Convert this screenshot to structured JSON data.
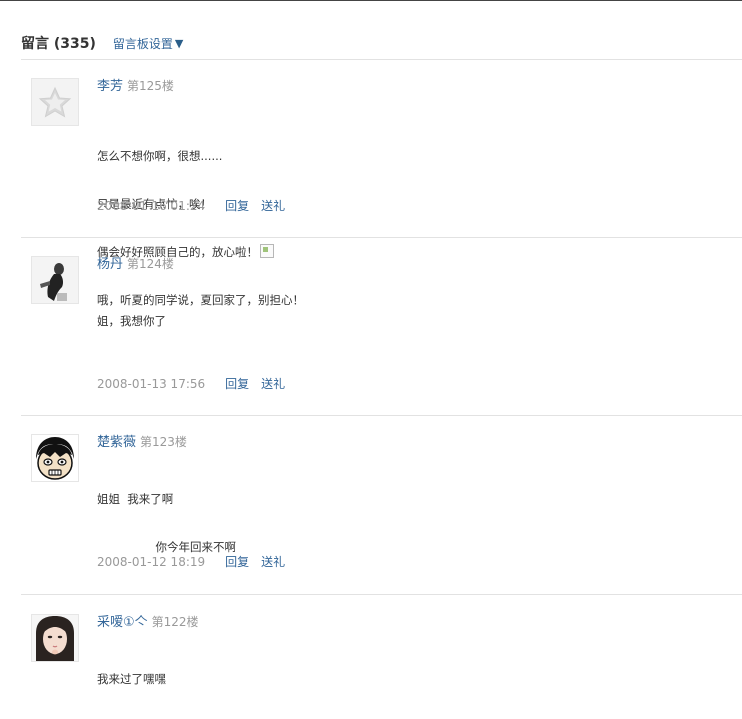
{
  "header": {
    "title": "留言 (335)",
    "settings_label": "留言板设置",
    "settings_arrow": "▼"
  },
  "messages": [
    {
      "name": "李芳",
      "floor": "第125楼",
      "lines": [
        "怎么不想你啊，很想......",
        "只是最近有点忙，唉！",
        "偶会好好照顾自己的，放心啦！",
        "哦，听夏的同学说，夏回家了，别担心！"
      ],
      "time": "2008-01-16 01:24",
      "reply_label": "回复",
      "gift_label": "送礼",
      "avatar_icon": "default-avatar-star-icon"
    },
    {
      "name": "杨丹",
      "floor": "第124楼",
      "lines": [
        "姐，我想你了"
      ],
      "time": "2008-01-13 17:56",
      "reply_label": "回复",
      "gift_label": "送礼"
    },
    {
      "name": "楚紫薇",
      "floor": "第123楼",
      "lines": [
        "姐姐  我来了啊",
        "                你今年回来不啊"
      ],
      "time": "2008-01-12 18:19",
      "reply_label": "回复",
      "gift_label": "送礼"
    },
    {
      "name": "采嗳①亽",
      "floor": "第122楼",
      "lines": [
        "我来过了嘿嘿"
      ]
    }
  ]
}
